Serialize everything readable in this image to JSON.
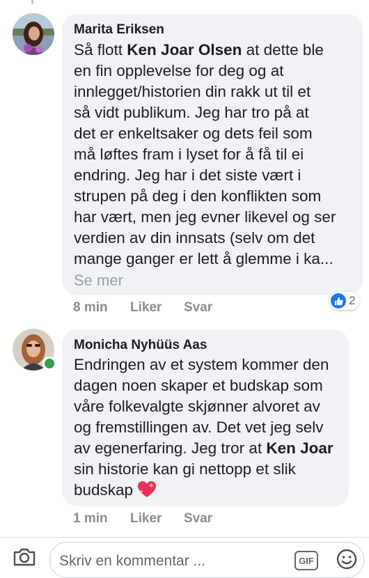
{
  "comments": [
    {
      "author": "Marita Eriksen",
      "text_parts": [
        "Så flott ",
        "Ken Joar Olsen",
        " at dette ble\nen fin opplevelse for deg og at\ninnlegget/historien din rakk ut til et\nså vidt publikum. Jeg har tro på at\ndet er enkeltsaker og dets feil som\nmå løftes fram i lyset for å få til ei\nendring. Jeg har i det siste vært i\nstrupen på deg i den konflikten som\nhar vært, men jeg evner likevel og ser\nverdien av din innsats (selv om det\nmange ganger er lett å glemme i ka..."
      ],
      "see_more": "Se mer",
      "time": "8 min",
      "like_label": "Liker",
      "reply_label": "Svar",
      "reaction_count": "2",
      "reaction_icon": "thumbs-up-icon",
      "online": false
    },
    {
      "author": "Monicha Nyhüüs Aas",
      "text_parts": [
        "Endringen av et system kommer den\ndagen noen skaper et budskap som\nvåre folkevalgte skjønner alvoret av\nog fremstillingen av. Det vet jeg selv\nav egenerfaring. Jeg tror at ",
        "Ken Joar",
        "\nsin historie kan gi nettopp et slik\nbudskap "
      ],
      "emoji": "sparkling-heart",
      "time": "1 min",
      "like_label": "Liker",
      "reply_label": "Svar",
      "online": true
    }
  ],
  "composer": {
    "placeholder": "Skriv en kommentar ...",
    "gif_label": "GIF",
    "camera_icon": "camera-icon",
    "emoji_icon": "smiley-icon"
  },
  "colors": {
    "bubble": "#f0f2f5",
    "meta": "#8a8d91",
    "like_blue": "#1877f2",
    "online_green": "#31a24c"
  }
}
